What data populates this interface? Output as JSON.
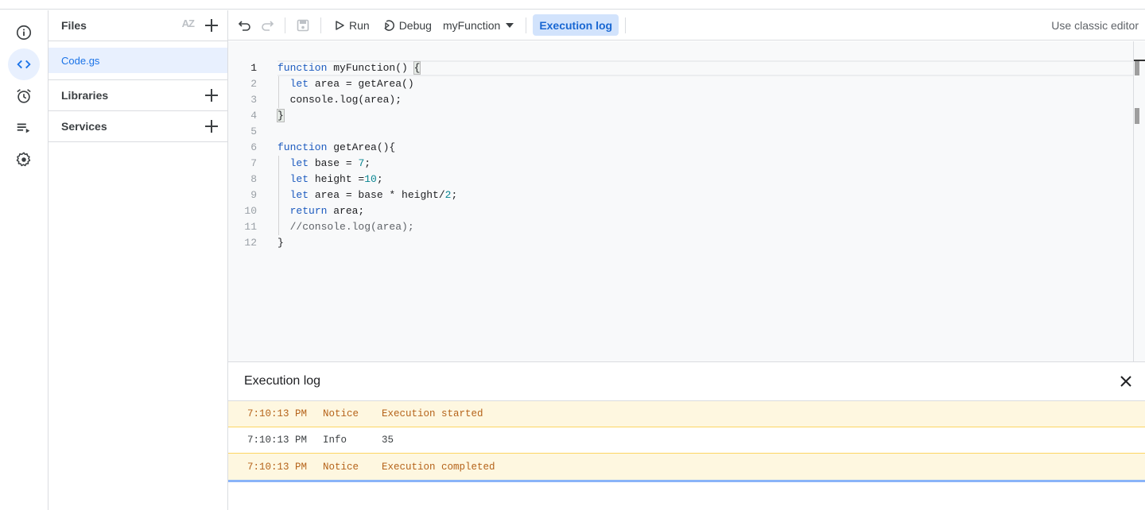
{
  "rail": {
    "items": [
      {
        "icon": "info-icon",
        "label": "Overview"
      },
      {
        "icon": "code-icon",
        "label": "Editor",
        "active": true
      },
      {
        "icon": "alarm-icon",
        "label": "Triggers"
      },
      {
        "icon": "executions-icon",
        "label": "Executions"
      },
      {
        "icon": "gear-icon",
        "label": "Project Settings"
      }
    ]
  },
  "files": {
    "header": "Files",
    "sort_label": "AZ",
    "items": [
      "Code.gs"
    ],
    "libraries_label": "Libraries",
    "services_label": "Services"
  },
  "toolbar": {
    "run_label": "Run",
    "debug_label": "Debug",
    "function_selected": "myFunction",
    "execution_log_label": "Execution log",
    "classic_editor_label": "Use classic editor"
  },
  "editor": {
    "current_line": 1,
    "lines": [
      "function myFunction() {",
      "  let area = getArea()",
      "  console.log(area);",
      "}",
      "",
      "function getArea(){",
      "  let base = 7;",
      "  let height =10;",
      "  let area = base * height/2;",
      "  return area;",
      "  //console.log(area);",
      "}"
    ]
  },
  "execution_log": {
    "title": "Execution log",
    "rows": [
      {
        "time": "7:10:13 PM",
        "level": "Notice",
        "message": "Execution started"
      },
      {
        "time": "7:10:13 PM",
        "level": "Info",
        "message": "35"
      },
      {
        "time": "7:10:13 PM",
        "level": "Notice",
        "message": "Execution completed"
      }
    ]
  },
  "colors": {
    "accent": "#1a73e8",
    "active_bg": "#e8f0fe",
    "notice_bg": "#fef7e0",
    "notice_text": "#b5631a",
    "keyword": "#1d5bbf",
    "number": "#098591"
  }
}
